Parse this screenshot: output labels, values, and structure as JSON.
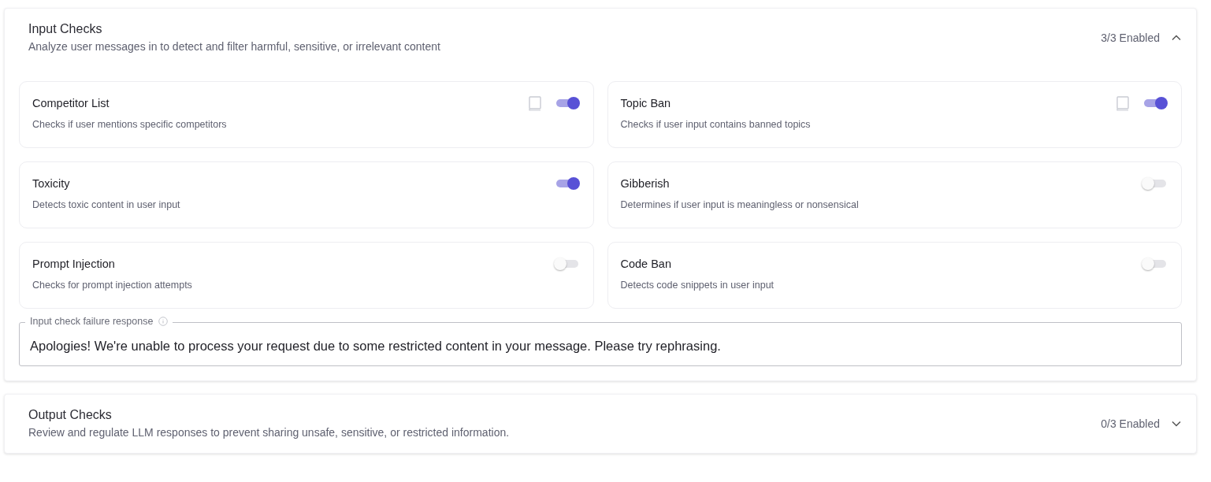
{
  "sections": [
    {
      "title": "Input Checks",
      "description": "Analyze user messages in to detect and filter harmful, sensitive, or irrelevant content",
      "count": "3/3 Enabled",
      "expanded": true,
      "checks": [
        {
          "name": "Competitor List",
          "description": "Checks if user mentions specific competitors",
          "has_guide": true,
          "on": true
        },
        {
          "name": "Topic Ban",
          "description": "Checks if user input contains banned topics",
          "has_guide": true,
          "on": true
        },
        {
          "name": "Toxicity",
          "description": "Detects toxic content in user input",
          "has_guide": false,
          "on": true
        },
        {
          "name": "Gibberish",
          "description": "Determines if user input is meaningless or nonsensical",
          "has_guide": false,
          "on": false
        },
        {
          "name": "Prompt Injection",
          "description": "Checks for prompt injection attempts",
          "has_guide": false,
          "on": false
        },
        {
          "name": "Code Ban",
          "description": "Detects code snippets in user input",
          "has_guide": false,
          "on": false
        }
      ],
      "response_field": {
        "label": "Input check failure response",
        "value": "Apologies! We're unable to process your request due to some restricted content in your message. Please try rephrasing."
      }
    },
    {
      "title": "Output Checks",
      "description": "Review and regulate LLM responses to prevent sharing unsafe, sensitive, or restricted information.",
      "count": "0/3 Enabled",
      "expanded": false
    }
  ]
}
